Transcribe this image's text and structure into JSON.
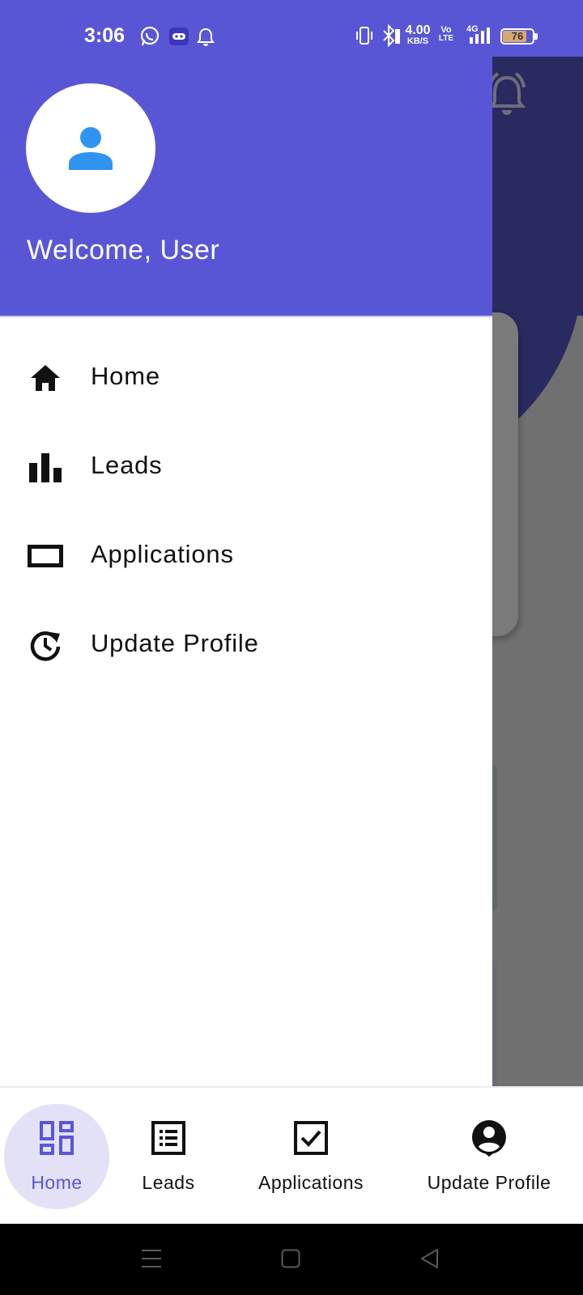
{
  "status_bar": {
    "time": "3:06",
    "net_speed_value": "4.00",
    "net_speed_unit": "KB/S",
    "volte_top": "Vo",
    "volte_bottom": "LTE",
    "network_type": "4G",
    "battery_level": "76",
    "icons": [
      "whatsapp-icon",
      "game-icon",
      "notification-bell-icon",
      "vibrate-icon",
      "bluetooth-icon",
      "signal-icon",
      "battery-icon"
    ]
  },
  "drawer": {
    "welcome_text": "Welcome, User",
    "header_color": "#5956d6",
    "avatar_icon_color": "#2f94f0",
    "items": [
      {
        "label": "Home",
        "icon": "home-icon"
      },
      {
        "label": "Leads",
        "icon": "bar-chart-icon"
      },
      {
        "label": "Applications",
        "icon": "rectangle-icon"
      },
      {
        "label": "Update Profile",
        "icon": "history-icon"
      }
    ]
  },
  "bottom_nav": {
    "active_index": 0,
    "active_color": "#5956d6",
    "items": [
      {
        "label": "Home",
        "icon": "dashboard-icon"
      },
      {
        "label": "Leads",
        "icon": "list-icon"
      },
      {
        "label": "Applications",
        "icon": "checkbox-icon"
      },
      {
        "label": "Update Profile",
        "icon": "account-circle-icon"
      }
    ]
  },
  "system_nav": {
    "icons": [
      "menu-icon",
      "home-square-icon",
      "back-triangle-icon"
    ]
  }
}
